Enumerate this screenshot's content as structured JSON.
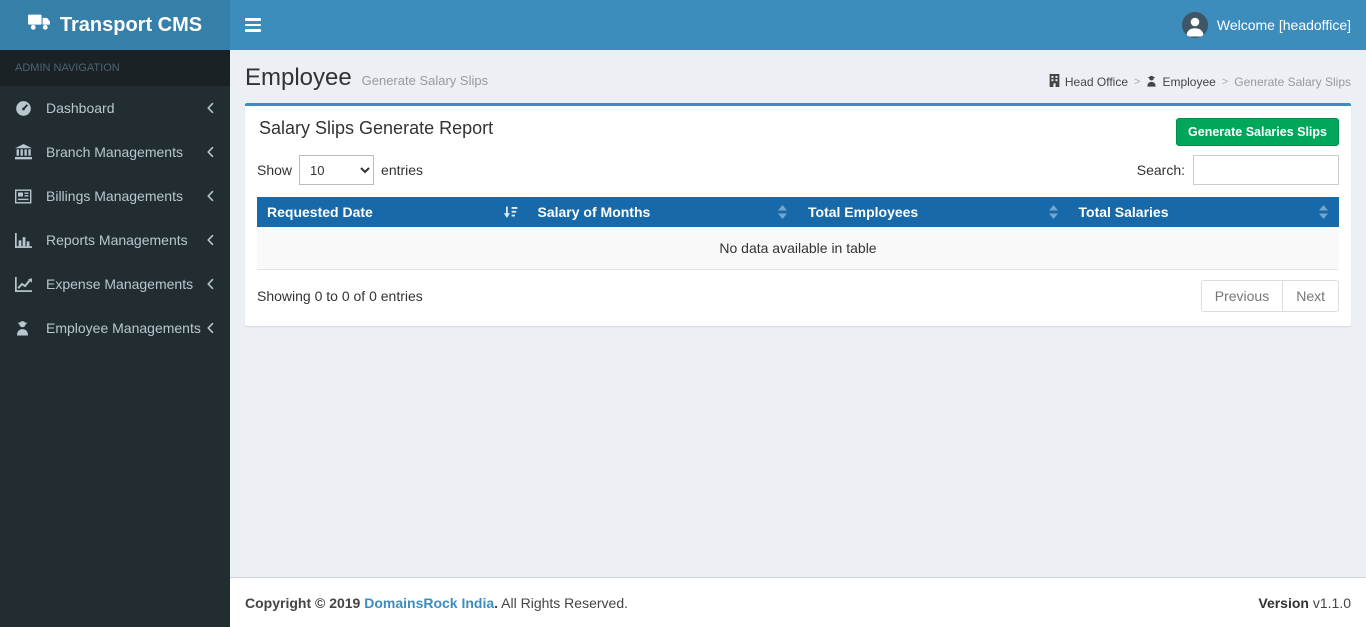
{
  "header": {
    "brand": "Transport CMS",
    "welcome": "Welcome [headoffice]"
  },
  "sidebar": {
    "section_label": "ADMIN NAVIGATION",
    "items": [
      {
        "label": "Dashboard",
        "icon": "dashboard-icon"
      },
      {
        "label": "Branch Managements",
        "icon": "bank-icon"
      },
      {
        "label": "Billings Managements",
        "icon": "newspaper-icon"
      },
      {
        "label": "Reports Managements",
        "icon": "bar-chart-icon"
      },
      {
        "label": "Expense Managements",
        "icon": "line-chart-icon"
      },
      {
        "label": "Employee Managements",
        "icon": "user-secret-icon"
      }
    ]
  },
  "content": {
    "page_title": "Employee",
    "page_subtitle": "Generate Salary Slips",
    "breadcrumb": [
      {
        "label": "Head Office",
        "icon": "building-icon"
      },
      {
        "label": "Employee",
        "icon": "user-secret-icon"
      },
      {
        "label": "Generate Salary Slips",
        "icon": ""
      }
    ],
    "box": {
      "title": "Salary Slips Generate Report",
      "generate_button": "Generate Salaries Slips",
      "show_label": "Show",
      "entries_label": "entries",
      "page_length": "10",
      "search_label": "Search:",
      "table": {
        "columns": [
          "Requested Date",
          "Salary of Months",
          "Total Employees",
          "Total Salaries"
        ],
        "empty_message": "No data available in table"
      },
      "info": "Showing 0 to 0 of 0 entries",
      "pagination": {
        "previous": "Previous",
        "next": "Next"
      }
    }
  },
  "footer": {
    "copyright_bold": "Copyright © 2019",
    "company_link": "DomainsRock India",
    "dot": ".",
    "rights": " All Rights Reserved.",
    "version_label": "Version",
    "version_value": " v1.1.0"
  },
  "colors": {
    "navbar_blue": "#3c8dbc",
    "logo_blue": "#367fa9",
    "sidebar_dark": "#222d32",
    "table_header_blue": "#1769aa",
    "button_green": "#00a65a",
    "content_bg": "#ecf0f5",
    "link_blue": "#3c8dbc"
  }
}
